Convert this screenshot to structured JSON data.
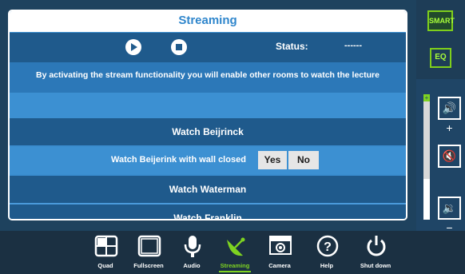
{
  "panel": {
    "title": "Streaming",
    "status_label": "Status:",
    "status_value": "------",
    "info_text": "By activating the stream functionality you will enable other rooms to watch the lecture",
    "watch_beijrinck": "Watch Beijrinck",
    "watch_closed_label": "Watch Beijerink with wall closed",
    "yes_label": "Yes",
    "no_label": "No",
    "watch_waterman": "Watch Waterman",
    "watch_franklin": "Watch Franklin"
  },
  "sidebar": {
    "brand": "SMART",
    "projector": "EQ",
    "volume_up_glyph": "🔊+",
    "mute_glyph": "🔇",
    "volume_down_glyph": "🔉−",
    "volume_level": 0.33
  },
  "nav": {
    "items": [
      {
        "label": "Quad"
      },
      {
        "label": "Fullscreen"
      },
      {
        "label": "Audio"
      },
      {
        "label": "Streaming"
      },
      {
        "label": "Camera"
      },
      {
        "label": "Help"
      },
      {
        "label": "Shut down"
      }
    ],
    "active_index": 3
  },
  "colors": {
    "panel_blue": "#3a8dcf",
    "row_dark": "#1f5a8c",
    "accent_green": "#7ed321",
    "background": "#1c3a52"
  }
}
